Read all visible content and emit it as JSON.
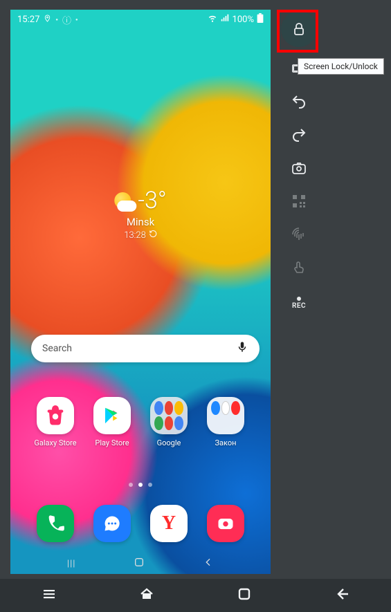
{
  "phone": {
    "status_bar": {
      "time": "15:27",
      "wifi_label": "wifi",
      "signal_label": "signal",
      "battery_text": "100%"
    },
    "weather": {
      "temperature": "-3°",
      "city": "Minsk",
      "time": "13:28"
    },
    "search": {
      "placeholder": "Search",
      "mic_label": "mic"
    },
    "apps_row": [
      {
        "label": "Galaxy Store",
        "bg": "#ffffff",
        "inner": "bag"
      },
      {
        "label": "Play Store",
        "bg": "#ffffff",
        "inner": "play"
      },
      {
        "label": "Google",
        "bg": "#dfe4ea",
        "inner": "folder"
      },
      {
        "label": "Закон",
        "bg": "#ffffff",
        "inner": "zakon"
      }
    ],
    "dock": [
      {
        "name": "phone",
        "bg": "#07b359"
      },
      {
        "name": "messages",
        "bg": "#1e7cff"
      },
      {
        "name": "yandex",
        "bg": "#ffffff"
      },
      {
        "name": "camera",
        "bg": "#ff2d55"
      }
    ],
    "nav": {
      "recent": "|||",
      "home": "◯",
      "back": "‹"
    }
  },
  "toolbar": {
    "lock_tooltip": "Screen Lock/Unlock",
    "rec_label": "REC"
  },
  "emu_bar": {
    "menu": "menu",
    "home": "home",
    "overview": "overview",
    "back": "back"
  }
}
